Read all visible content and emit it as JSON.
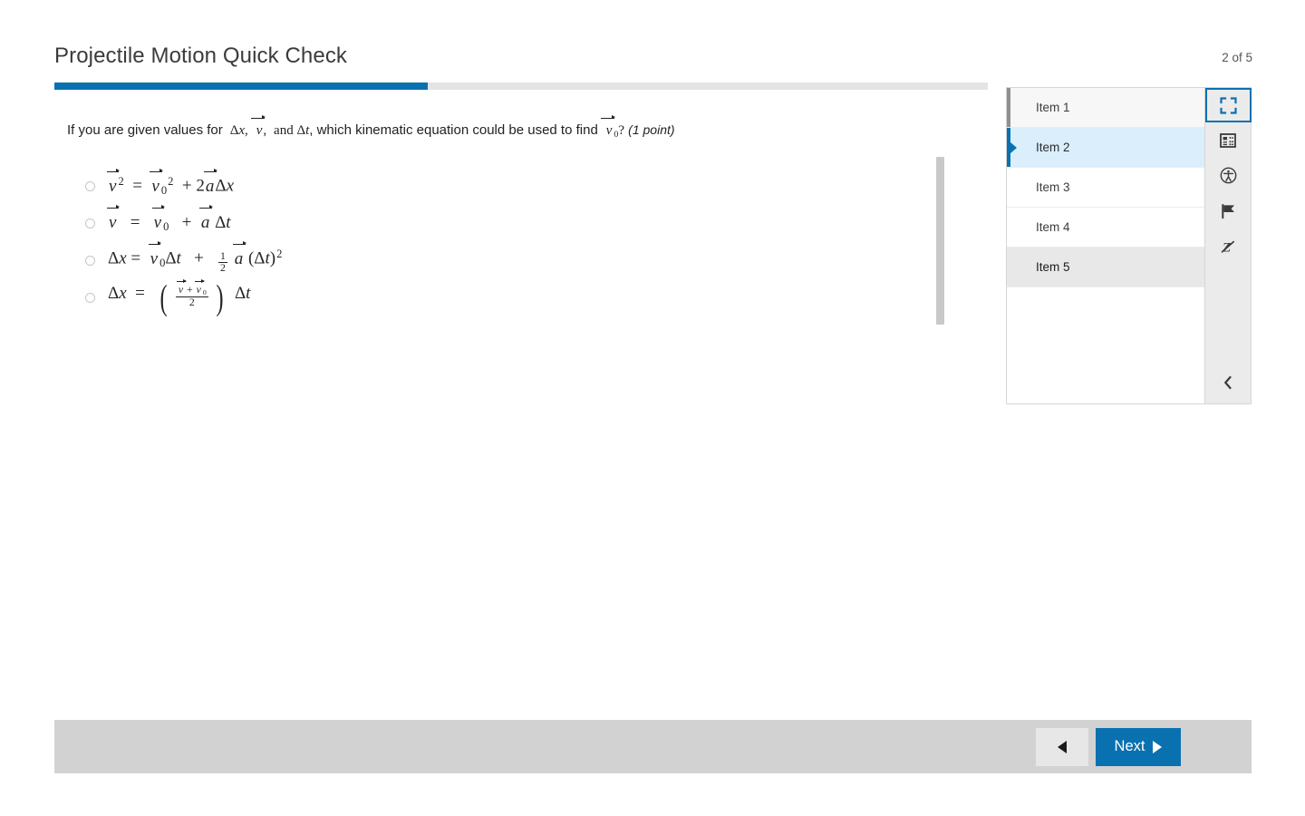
{
  "header": {
    "title": "Projectile Motion Quick Check",
    "counter": "2 of 5"
  },
  "progress": {
    "percent": 40,
    "fill_color": "#0a71b0",
    "track_color": "#e4e4e4"
  },
  "question": {
    "prefix": "If you are given values for",
    "middle": ", which kinematic equation could be used to find",
    "points": "(1 point)",
    "plain_text": "If you are given values for Δx, v⃗, and Δt, which kinematic equation could be used to find v⃗₀? (1 point)"
  },
  "options": [
    {
      "id": "option-a",
      "selected": false,
      "plain_text": "v⃗² = v⃗₀² + 2a⃗Δx"
    },
    {
      "id": "option-b",
      "selected": false,
      "plain_text": "v⃗ = v⃗₀ + a⃗Δt"
    },
    {
      "id": "option-c",
      "selected": false,
      "plain_text": "Δx = v⃗₀Δt + ½ a⃗ (Δt)²"
    },
    {
      "id": "option-d",
      "selected": false,
      "plain_text": "Δx = ( (v⃗ + v⃗₀) / 2 ) Δt"
    }
  ],
  "nav_panel": {
    "items": [
      {
        "label": "Item 1",
        "state": "seen"
      },
      {
        "label": "Item 2",
        "state": "current"
      },
      {
        "label": "Item 3",
        "state": "default"
      },
      {
        "label": "Item 4",
        "state": "default"
      },
      {
        "label": "Item 5",
        "state": "hovered"
      }
    ]
  },
  "tool_rail": {
    "buttons": [
      {
        "icon": "fullscreen-icon",
        "active": true
      },
      {
        "icon": "calculator-icon",
        "active": false
      },
      {
        "icon": "accessibility-icon",
        "active": false
      },
      {
        "icon": "flag-icon",
        "active": false
      },
      {
        "icon": "strikethrough-z-icon",
        "active": false
      }
    ],
    "collapse_icon": "chevron-left-icon"
  },
  "bottom_bar": {
    "previous_label": "",
    "previous_icon": "triangle-left-icon",
    "next_label": "Next",
    "next_icon": "triangle-right-icon",
    "next_color": "#0a71b0"
  }
}
